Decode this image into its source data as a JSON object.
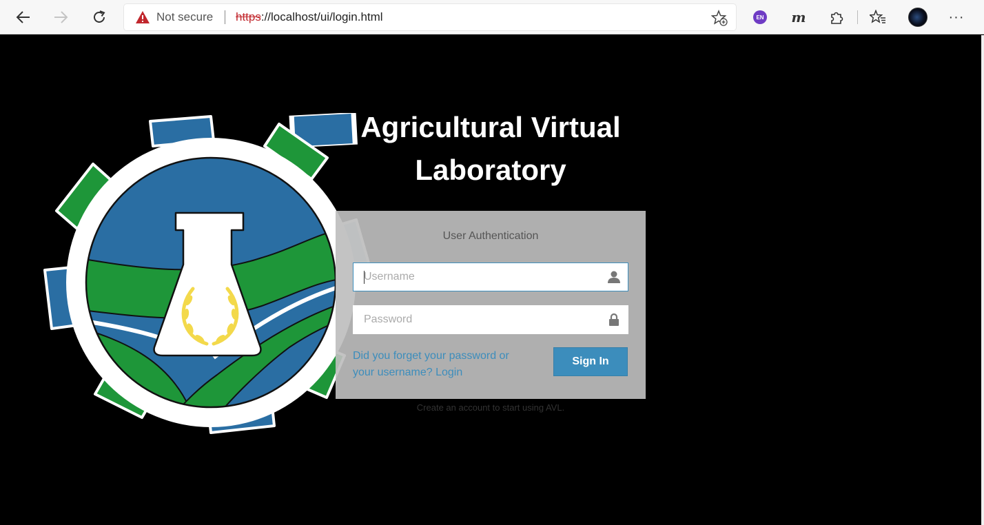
{
  "browser": {
    "back_icon": "back-arrow-icon",
    "forward_icon": "forward-arrow-icon",
    "refresh_icon": "refresh-icon",
    "security_label": "Not secure",
    "url_scheme": "https",
    "url_rest": "://localhost/ui/login.html",
    "language_badge": "EN",
    "extension_m": "m",
    "more_label": "···"
  },
  "page": {
    "title_line1": "Agricultural Virtual",
    "title_line2": "Laboratory",
    "auth": {
      "heading": "User Authentication",
      "username_placeholder": "Username",
      "password_placeholder": "Password",
      "forgot_text": "Did you forget your password or your username? Login",
      "signin_label": "Sign In"
    },
    "create_account_text": "Create an account to start using AVL."
  },
  "colors": {
    "accent": "#3c8dbc",
    "logo_blue": "#2a6ea3",
    "logo_green": "#1e9639",
    "warning_red": "#c1272d"
  }
}
